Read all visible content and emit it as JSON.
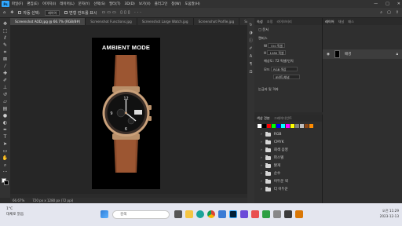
{
  "menubar": {
    "logo": "Ps",
    "items": [
      "파일(F)",
      "편집(E)",
      "이미지(I)",
      "레이어(L)",
      "문자(Y)",
      "선택(S)",
      "필터(T)",
      "3D(D)",
      "보기(V)",
      "플러그인",
      "창(W)",
      "도움말(H)"
    ],
    "window_controls": [
      "—",
      "□",
      "✕"
    ]
  },
  "options": {
    "auto_select_label": "자동 선택:",
    "auto_select_value": "레이어",
    "transform_label": "변형 컨트롤 표시"
  },
  "tabs": [
    {
      "label": "Screenshot AOD.jpg @ 66.7% (RGB/8#)",
      "active": true
    },
    {
      "label": "Screenshot Functions.jpg",
      "active": false
    },
    {
      "label": "Screenshot Large Watch.jpg",
      "active": false
    },
    {
      "label": "Screenshot Profile.jpg",
      "active": false
    },
    {
      "label": "Screenshot Profile.jpg",
      "active": false
    }
  ],
  "canvas": {
    "headline": "AMBIENT MODE"
  },
  "status": {
    "zoom": "66.67%",
    "dimensions": "720 px x 1280 px (72 ppi)"
  },
  "properties": {
    "tabs": [
      "속성",
      "조정",
      "라이브러리"
    ],
    "section_label": "문서",
    "canvas_label": "캔버스",
    "w_value": "720 픽셀",
    "h_value": "1280 픽셀",
    "resolution": "해상도: 72 픽셀/인치",
    "mode_label": "모드",
    "mode_value": "RGB 색상",
    "bits_value": "8비트/채널",
    "rulers_label": "눈금자 및 격자"
  },
  "swatches": {
    "tabs": [
      "색상 견본",
      "그레이디언트"
    ],
    "colors": [
      "#ffffff",
      "#000000",
      "#ff0000",
      "#00ff00",
      "#0000ff",
      "#00ffff",
      "#ff00ff",
      "#ffff00",
      "#808080",
      "#c0c0c0",
      "#8b4513",
      "#ff8c00"
    ],
    "folders": [
      "RGB",
      "CMYK",
      "회색 음영",
      "파스텔",
      "밝게",
      "순수",
      "어두운 색",
      "더 어두운"
    ]
  },
  "layers": {
    "tabs": [
      "레이어",
      "채널",
      "패스"
    ],
    "layer_name": "배경"
  },
  "taskbar": {
    "weather_temp": "1°C",
    "weather_desc": "대체로 맑음",
    "search_placeholder": "검색",
    "time": "오전 11:29",
    "date": "2023-12-13"
  }
}
